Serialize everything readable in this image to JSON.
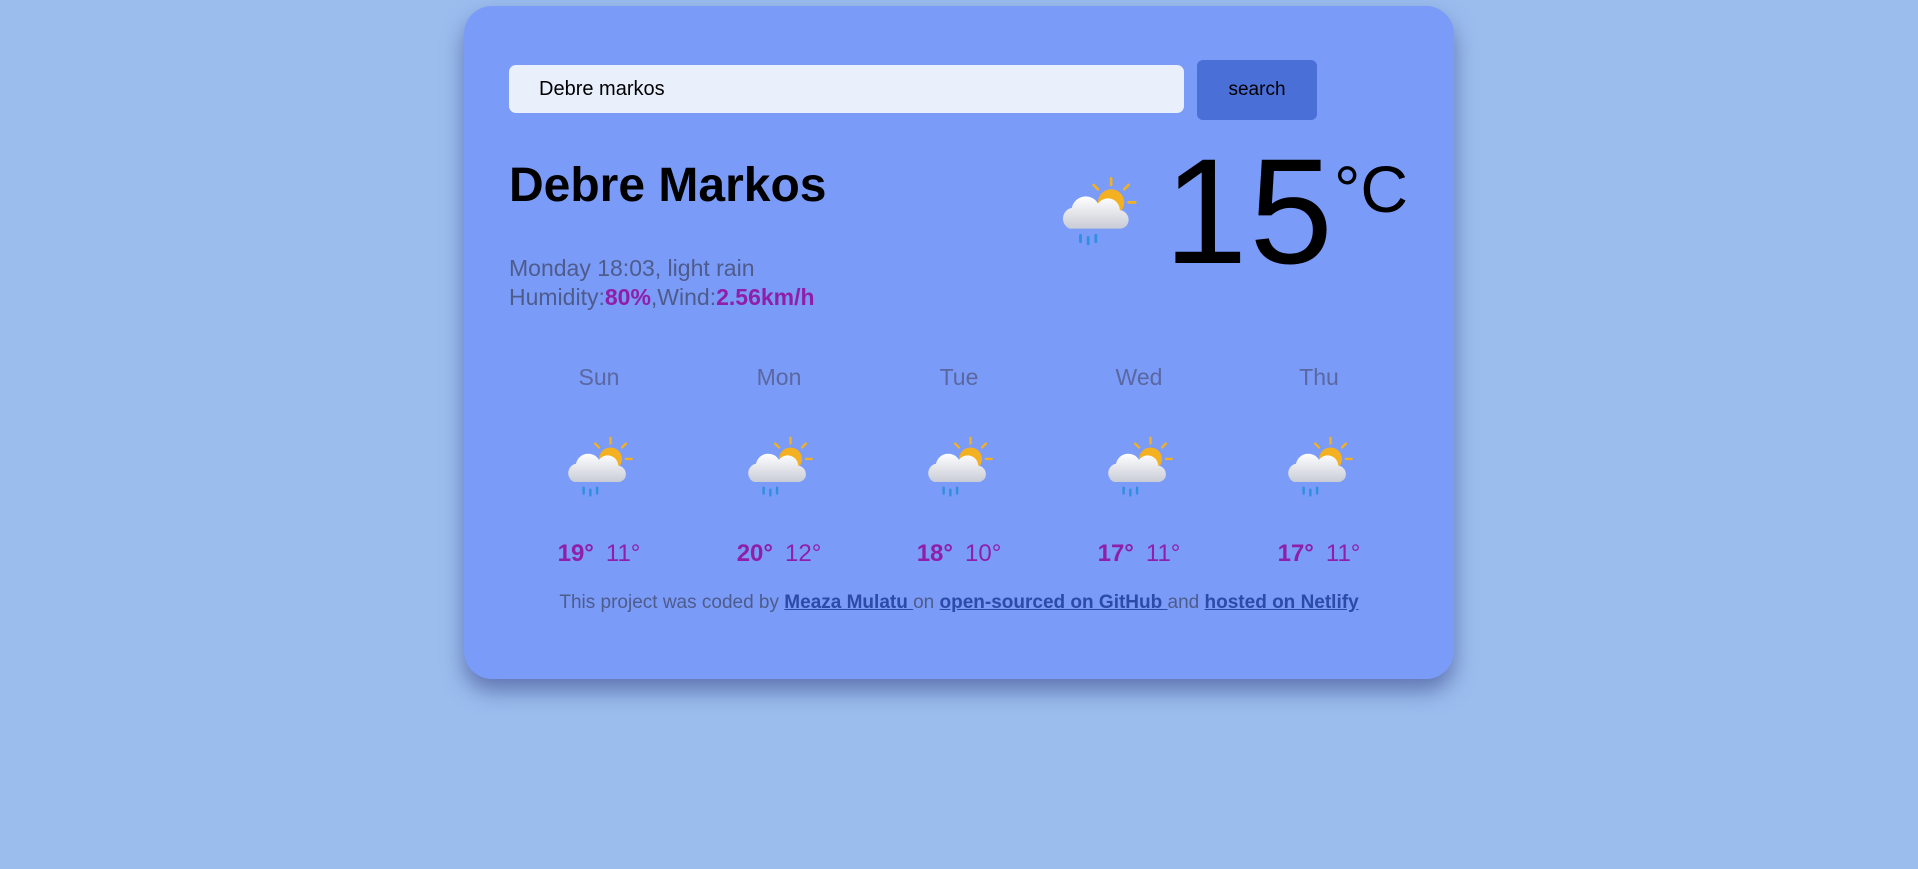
{
  "search": {
    "value": "Debre markos",
    "button_label": "search"
  },
  "current": {
    "city": "Debre Markos",
    "datetime_desc": "Monday 18:03, light rain",
    "humidity_label": "Humidity:",
    "humidity_value": "80%",
    "separator": ",",
    "wind_label": "Wind:",
    "wind_value": "2.56km/h",
    "temperature": "15",
    "unit": "°C",
    "icon": "cloud-sun-rain-icon"
  },
  "forecast": [
    {
      "day": "Sun",
      "max": "19°",
      "min": "11°",
      "icon": "cloud-sun-rain-icon"
    },
    {
      "day": "Mon",
      "max": "20°",
      "min": "12°",
      "icon": "cloud-sun-rain-icon"
    },
    {
      "day": "Tue",
      "max": "18°",
      "min": "10°",
      "icon": "cloud-sun-rain-icon"
    },
    {
      "day": "Wed",
      "max": "17°",
      "min": "11°",
      "icon": "cloud-sun-rain-icon"
    },
    {
      "day": "Thu",
      "max": "17°",
      "min": "11°",
      "icon": "cloud-sun-rain-icon"
    }
  ],
  "footer": {
    "text1": "This project was coded by ",
    "author_link": "Meaza Mulatu ",
    "text2": "on ",
    "github_link": "open-sourced on GitHub ",
    "text3": "and ",
    "netlify_link": "hosted on Netlify"
  },
  "colors": {
    "background": "#9bbdee",
    "card": "#7b9bf8",
    "accent": "#8f1fa8",
    "button": "#4a6fd6"
  }
}
